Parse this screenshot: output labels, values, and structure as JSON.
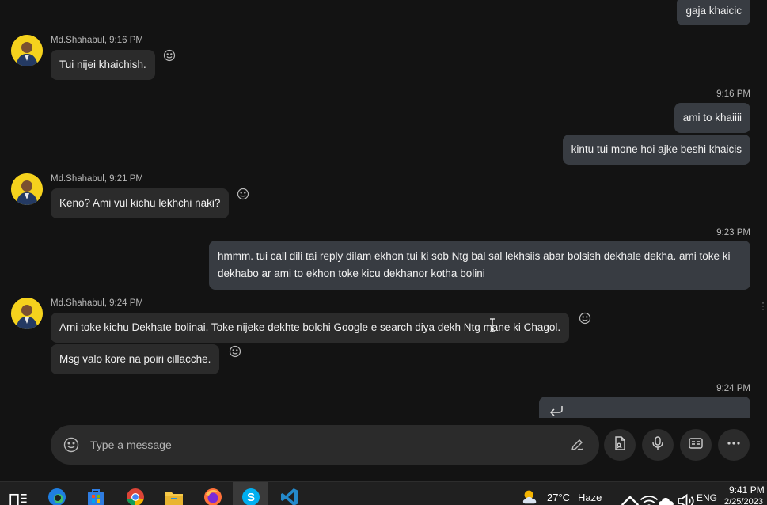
{
  "messages": [
    {
      "sender": "Md.Shahabul, 9:16 PM",
      "text": "Tui nijei khaichish."
    },
    {
      "time": "9:16 PM",
      "texts": [
        "ami to khaiiii",
        "kintu tui mone hoi ajke beshi khaicis"
      ]
    },
    {
      "sender": "Md.Shahabul, 9:21 PM",
      "text": "Keno? Ami vul kichu lekhchi naki?"
    },
    {
      "time": "9:23 PM",
      "text": "hmmm. tui call dili tai reply dilam ekhon tui ki sob Ntg bal sal lekhsiis abar bolsish dekhale dekha. ami toke ki dekhabo ar ami to ekhon toke kicu dekhanor kotha bolini"
    },
    {
      "sender": "Md.Shahabul, 9:24 PM",
      "texts": [
        "Ami toke kichu Dekhate bolinai. Toke nijeke dekhte bolchi Google e search diya dekh Ntg mane ki Chagol.",
        "Msg valo kore na poiri cillacche."
      ]
    },
    {
      "time": "9:24 PM"
    }
  ],
  "top_partial_message": "gaja khaicic",
  "composer": {
    "placeholder": "Type a message"
  },
  "taskbar": {
    "weather_temp": "27°C",
    "weather_text": "Haze",
    "language": "ENG",
    "clock_time": "9:41 PM",
    "clock_date": "2/25/2023"
  },
  "colors": {
    "background": "#131313",
    "incoming_bubble": "#2b2b2b",
    "outgoing_bubble": "#383c42",
    "avatar": "#f5d21d"
  },
  "icons": [
    "smiley-icon",
    "pen-icon",
    "file-icon",
    "mic-icon",
    "contact-card-icon",
    "more-icon",
    "reply-icon"
  ]
}
